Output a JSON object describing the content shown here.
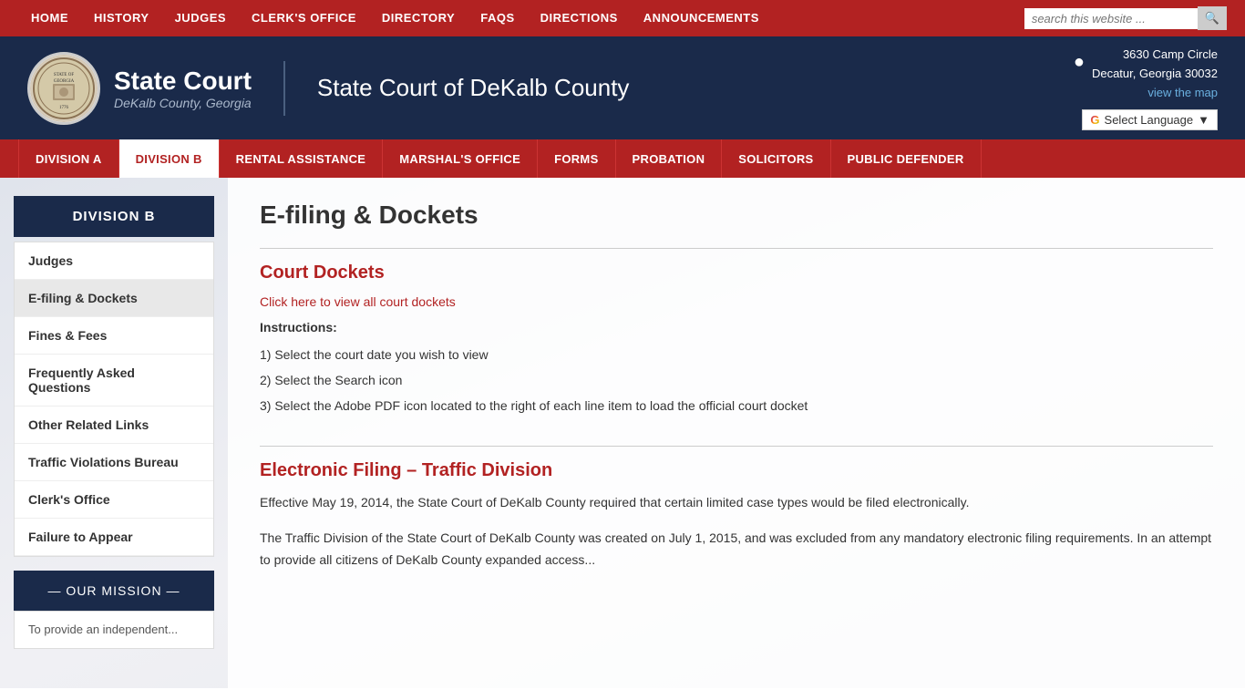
{
  "topNav": {
    "links": [
      {
        "label": "HOME",
        "href": "#"
      },
      {
        "label": "HISTORY",
        "href": "#"
      },
      {
        "label": "JUDGES",
        "href": "#"
      },
      {
        "label": "CLERK'S OFFICE",
        "href": "#"
      },
      {
        "label": "DIRECTORY",
        "href": "#"
      },
      {
        "label": "FAQS",
        "href": "#"
      },
      {
        "label": "DIRECTIONS",
        "href": "#"
      },
      {
        "label": "ANNOUNCEMENTS",
        "href": "#"
      }
    ],
    "searchPlaceholder": "search this website ..."
  },
  "header": {
    "courtName": "State Court",
    "courtSub": "DeKalb County, Georgia",
    "courtFull": "State Court of DeKalb County",
    "address": {
      "line1": "3630 Camp Circle",
      "line2": "Decatur, Georgia 30032",
      "mapLink": "view the map"
    },
    "languageLabel": "Select Language"
  },
  "secondaryNav": {
    "links": [
      {
        "label": "DIVISION A",
        "active": false
      },
      {
        "label": "DIVISION B",
        "active": true
      },
      {
        "label": "RENTAL ASSISTANCE",
        "active": false
      },
      {
        "label": "MARSHAL'S OFFICE",
        "active": false
      },
      {
        "label": "FORMS",
        "active": false
      },
      {
        "label": "PROBATION",
        "active": false
      },
      {
        "label": "SOLICITORS",
        "active": false
      },
      {
        "label": "PUBLIC DEFENDER",
        "active": false
      }
    ]
  },
  "sidebar": {
    "title": "DIVISION B",
    "menu": [
      {
        "label": "Judges",
        "active": false
      },
      {
        "label": "E-filing & Dockets",
        "active": true
      },
      {
        "label": "Fines & Fees",
        "active": false
      },
      {
        "label": "Frequently Asked Questions",
        "active": false
      },
      {
        "label": "Other Related Links",
        "active": false
      },
      {
        "label": "Traffic Violations Bureau",
        "active": false
      },
      {
        "label": "Clerk's Office",
        "active": false
      },
      {
        "label": "Failure to Appear",
        "active": false
      }
    ],
    "missionTitle": "— OUR MISSION —",
    "missionText": "To provide an independent..."
  },
  "content": {
    "pageTitle": "E-filing & Dockets",
    "section1": {
      "title": "Court Dockets",
      "linkText": "Click here to view all court dockets",
      "instructionsLabel": "Instructions:",
      "instructions": [
        "1) Select the court date you wish to view",
        "2) Select the Search icon",
        "3) Select the Adobe PDF icon located to the right of each line item to load the official court docket"
      ]
    },
    "section2": {
      "title": "Electronic Filing – Traffic Division",
      "para1": "Effective May 19, 2014, the State Court of DeKalb County required that certain limited case types would be filed electronically.",
      "para2": "The Traffic Division of the State Court of DeKalb County was created on July 1, 2015, and was excluded from any mandatory electronic filing requirements. In an attempt to provide all citizens of DeKalb County expanded access..."
    }
  }
}
